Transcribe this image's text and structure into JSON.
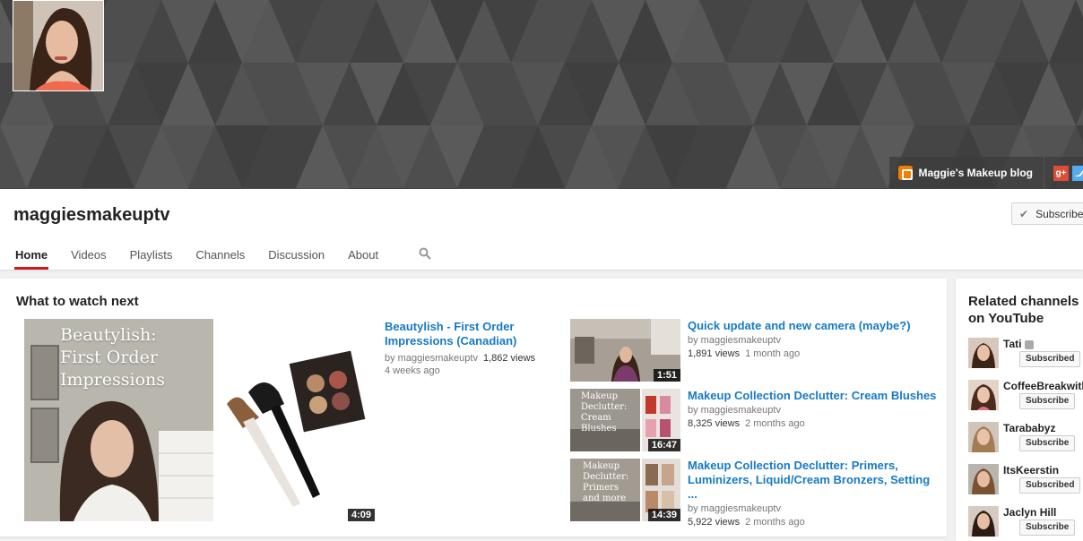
{
  "channel": {
    "name": "maggiesmakeuptv",
    "subscribe_label": "Subscribe",
    "blog_link": "Maggie's Makeup blog",
    "gplus_label": "g+"
  },
  "tabs": [
    {
      "label": "Home",
      "active": true
    },
    {
      "label": "Videos"
    },
    {
      "label": "Playlists"
    },
    {
      "label": "Channels"
    },
    {
      "label": "Discussion"
    },
    {
      "label": "About"
    }
  ],
  "section": {
    "title": "What to watch next"
  },
  "featured": {
    "thumb_lines": [
      "Beautylish:",
      "First Order",
      "Impressions"
    ],
    "duration": "4:09",
    "title": "Beautylish - First Order Impressions (Canadian)",
    "byline": "by maggiesmakeuptv",
    "views": "1,862 views",
    "age": "4 weeks ago"
  },
  "videos": [
    {
      "title": "Quick update and new camera (maybe?)",
      "byline": "by maggiesmakeuptv",
      "views": "1,891 views",
      "age": "1 month ago",
      "duration": "1:51",
      "thumb_text": ""
    },
    {
      "title": "Makeup Collection Declutter: Cream Blushes",
      "byline": "by maggiesmakeuptv",
      "views": "8,325 views",
      "age": "2 months ago",
      "duration": "16:47",
      "thumb_text": "Makeup Declutter: Cream Blushes"
    },
    {
      "title": "Makeup Collection Declutter: Primers, Luminizers, Liquid/Cream Bronzers, Setting ...",
      "byline": "by maggiesmakeuptv",
      "views": "5,922 views",
      "age": "2 months ago",
      "duration": "14:39",
      "thumb_text": "Makeup Declutter: Primers and more"
    }
  ],
  "related": {
    "title": "Related channels on YouTube",
    "channels": [
      {
        "name": "Tati",
        "button": "Subscribed",
        "verified": true
      },
      {
        "name": "CoffeeBreakwithDani",
        "button": "Subscribe"
      },
      {
        "name": "Tarababyz",
        "button": "Subscribe"
      },
      {
        "name": "ItsKeerstin",
        "button": "Subscribed"
      },
      {
        "name": "Jaclyn Hill",
        "button": "Subscribe"
      }
    ]
  },
  "colors": {
    "accent_red": "#cc181e",
    "link_blue": "#167ac6",
    "banner_gray": "#4a4a4a"
  }
}
